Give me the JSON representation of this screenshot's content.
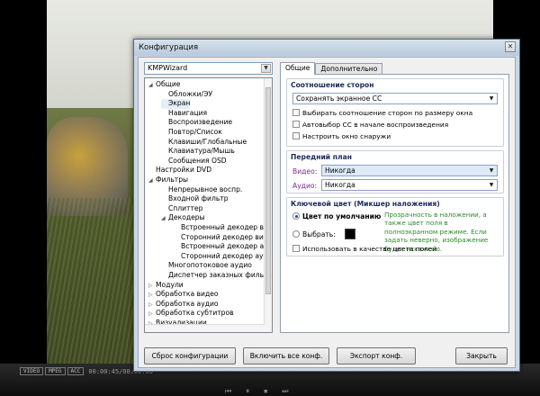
{
  "dialog": {
    "title": "Конфигурация",
    "close_glyph": "✕",
    "preset": "KMPWizard",
    "tabs": [
      {
        "label": "Общие"
      },
      {
        "label": "Дополнительно"
      }
    ]
  },
  "tree": [
    {
      "label": "Общие",
      "exp": "◢"
    },
    {
      "label": "Обложки/ЭУ",
      "exp": ""
    },
    {
      "label": "Экран",
      "exp": ""
    },
    {
      "label": "Навигация",
      "exp": ""
    },
    {
      "label": "Воспроизведение",
      "exp": ""
    },
    {
      "label": "Повтор/Список",
      "exp": ""
    },
    {
      "label": "Клавиши/Глобальные",
      "exp": ""
    },
    {
      "label": "Клавиатура/Мышь",
      "exp": ""
    },
    {
      "label": "Сообщения OSD",
      "exp": ""
    },
    {
      "label": "Настройки DVD",
      "exp": ""
    },
    {
      "label": "Фильтры",
      "exp": "◢"
    },
    {
      "label": "Непрерывное воспр.",
      "exp": ""
    },
    {
      "label": "Входной фильтр",
      "exp": ""
    },
    {
      "label": "Сплиттер",
      "exp": ""
    },
    {
      "label": "Декодеры",
      "exp": "◢"
    },
    {
      "label": "Встроенный декодер видео",
      "exp": ""
    },
    {
      "label": "Сторонний декодер видео",
      "exp": ""
    },
    {
      "label": "Встроенный декодер аудио",
      "exp": ""
    },
    {
      "label": "Сторонний декодер аудио",
      "exp": ""
    },
    {
      "label": "Многопотоковое аудио",
      "exp": ""
    },
    {
      "label": "Диспетчер заказных фильтров",
      "exp": ""
    },
    {
      "label": "Модули",
      "exp": "▷"
    },
    {
      "label": "Обработка видео",
      "exp": "▷"
    },
    {
      "label": "Обработка аудио",
      "exp": "▷"
    },
    {
      "label": "Обработка субтитров",
      "exp": "▷"
    },
    {
      "label": "Визуализации",
      "exp": "▷"
    }
  ],
  "aspect": {
    "title": "Соотношение сторон",
    "mode": "Сохранять экранное СС",
    "options": [
      {
        "label": "Выбирать соотношение сторон по размеру окна"
      },
      {
        "label": "Автовыбор СС в начале воспроизведения"
      },
      {
        "label": "Настроить окно снаружи"
      }
    ]
  },
  "foreground": {
    "title": "Передний план",
    "video_label": "Видео:",
    "video_value": "Никогда",
    "audio_label": "Аудио:",
    "audio_value": "Никогда"
  },
  "colorkey": {
    "title": "Ключевой цвет (Микшер наложения)",
    "default_label": "Цвет по умолчанию",
    "choose_label": "Выбрать:",
    "hint": "Прозрачность в наложении, а также цвет поля в полноэкранном режиме. Если задать неверно, изображение будет искажено.",
    "field_color_label": "Использовать в качестве цвета полей",
    "swatch_color": "#000000"
  },
  "buttons": {
    "reset": "Сброс конфигурации",
    "enable_all": "Включить все конф.",
    "export": "Экспорт конф.",
    "close": "Закрыть"
  },
  "player": {
    "badges": [
      "VIDEO",
      "MPEG",
      "ACC"
    ],
    "time": "00:00:45/00:00:00",
    "controls": [
      "⏮",
      "⏸",
      "⏹",
      "⏭"
    ]
  },
  "colors": {
    "accent": "#1b4fa8",
    "hint_text": "#2c8a2c",
    "label_purple": "#7a2a8a"
  }
}
